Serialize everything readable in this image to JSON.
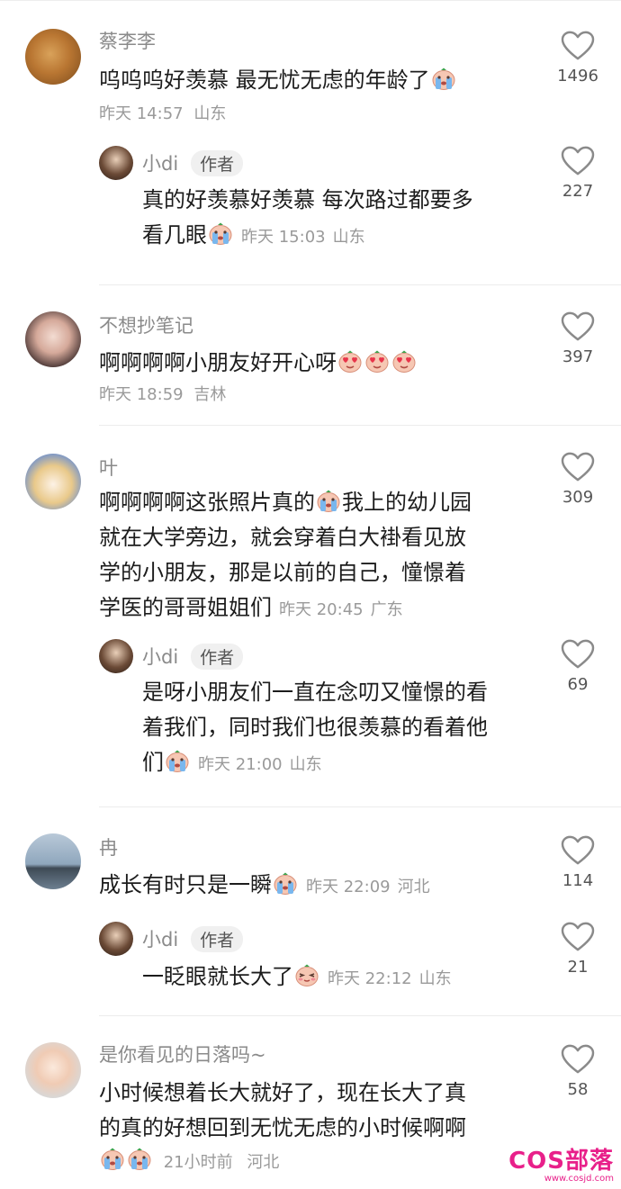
{
  "colors": {
    "accent": "#e8208a",
    "muted": "#9a9a9a",
    "text": "#1c1c1c"
  },
  "icons": {
    "like": "heart-outline-icon",
    "emoji_cry": "crying-face-emoji",
    "emoji_love": "heart-eyes-face-emoji",
    "emoji_shy": "blushing-face-emoji"
  },
  "comments": [
    {
      "name": "蔡李李",
      "text": "呜呜呜好羡慕 最无忧无虑的年龄了",
      "time": "昨天 14:57",
      "loc": "山东",
      "likes": "1496"
    },
    {
      "name": "小di",
      "tag": "作者",
      "text_line1": "真的好羡慕好羡慕 每次路过都要多",
      "text_line2": "看几眼",
      "time": "昨天 15:03",
      "loc": "山东",
      "likes": "227"
    },
    {
      "name": "不想抄笔记",
      "text": "啊啊啊啊小朋友好开心呀",
      "time": "昨天 18:59",
      "loc": "吉林",
      "likes": "397"
    },
    {
      "name": "叶",
      "text_line1a": "啊啊啊啊这张照片真的",
      "text_line1b": "我上的幼儿园",
      "text_line2": "就在大学旁边，就会穿着白大褂看见放",
      "text_line3": "学的小朋友，那是以前的自己，憧憬着",
      "text_line4": "学医的哥哥姐姐们",
      "time": "昨天 20:45",
      "loc": "广东",
      "likes": "309"
    },
    {
      "name": "小di",
      "tag": "作者",
      "text_line1": "是呀小朋友们一直在念叨又憧憬的看",
      "text_line2": "着我们，同时我们也很羡慕的看着他",
      "text_line3": "们",
      "time": "昨天 21:00",
      "loc": "山东",
      "likes": "69"
    },
    {
      "name": "冉",
      "text": "成长有时只是一瞬",
      "time": "昨天 22:09",
      "loc": "河北",
      "likes": "114"
    },
    {
      "name": "小di",
      "tag": "作者",
      "text": "一眨眼就长大了",
      "time": "昨天 22:12",
      "loc": "山东",
      "likes": "21"
    },
    {
      "name": "是你看见的日落吗~",
      "text_line1": "小时候想着长大就好了，现在长大了真",
      "text_line2": "的真的好想回到无忧无虑的小时候啊啊",
      "time": "21小时前",
      "loc": "河北",
      "likes": "58"
    }
  ],
  "watermark": {
    "main": "COS部落",
    "sub": "www.cosjd.com"
  }
}
